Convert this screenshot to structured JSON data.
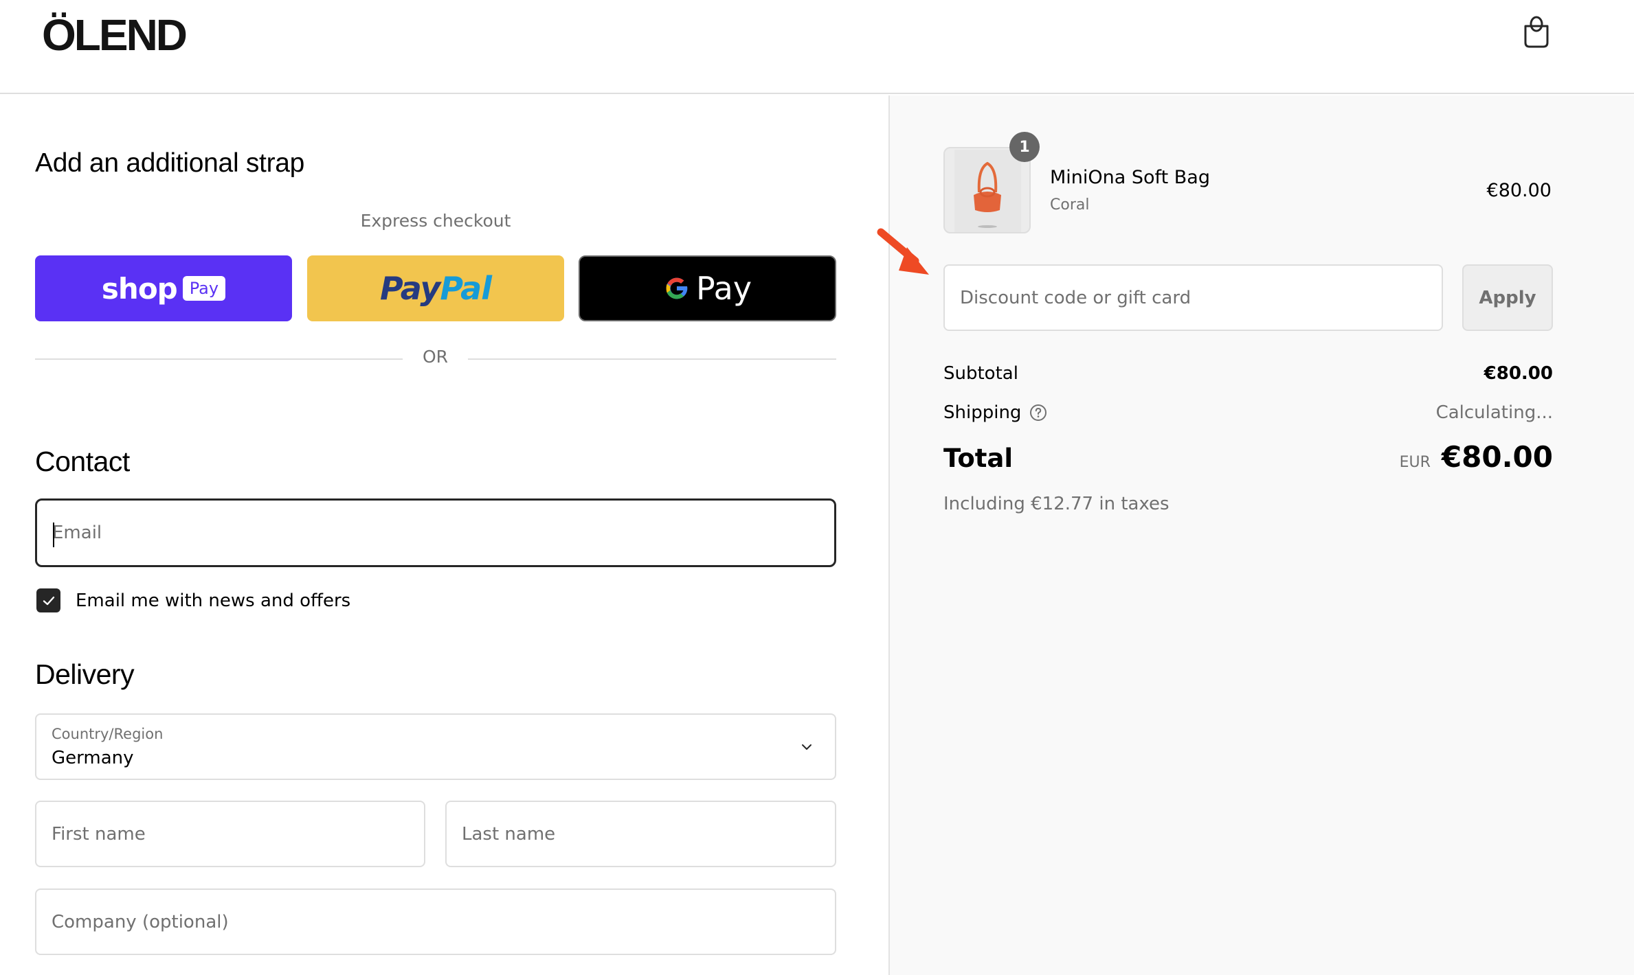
{
  "header": {
    "logo": "ÖLEND",
    "cart_icon": "shopping-bag-icon"
  },
  "checkout": {
    "upsell_heading": "Add an additional strap",
    "express_checkout_label": "Express checkout",
    "express_buttons": {
      "shop_pay": {
        "word": "shop",
        "badge": "Pay"
      },
      "paypal": {
        "part1": "Pay",
        "part2": "Pal"
      },
      "google_pay": {
        "word": "Pay"
      }
    },
    "divider_label": "OR",
    "contact": {
      "heading": "Contact",
      "email_placeholder": "Email",
      "email_value": "",
      "newsletter_label": "Email me with news and offers",
      "newsletter_checked": true
    },
    "delivery": {
      "heading": "Delivery",
      "country_label": "Country/Region",
      "country_value": "Germany",
      "first_name_placeholder": "First name",
      "last_name_placeholder": "Last name",
      "company_placeholder": "Company (optional)"
    }
  },
  "order_summary": {
    "item": {
      "quantity": "1",
      "name": "MiniOna Soft Bag",
      "variant": "Coral",
      "price": "€80.00"
    },
    "discount_placeholder": "Discount code or gift card",
    "apply_label": "Apply",
    "subtotal_label": "Subtotal",
    "subtotal_value": "€80.00",
    "shipping_label": "Shipping",
    "shipping_value": "Calculating...",
    "total_label": "Total",
    "total_currency": "EUR",
    "total_value": "€80.00",
    "tax_note": "Including €12.77 in taxes"
  },
  "colors": {
    "shop_pay": "#5a31f4",
    "paypal": "#f2c54e",
    "google_pay": "#000000",
    "annotation_arrow": "#ee4a24"
  }
}
